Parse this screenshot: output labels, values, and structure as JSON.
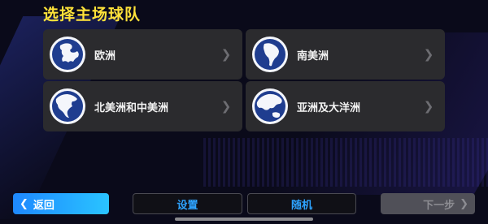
{
  "screen": {
    "title": "选择主场球队"
  },
  "regions": [
    {
      "label": "欧洲",
      "icon": "globe-europe-icon"
    },
    {
      "label": "南美洲",
      "icon": "globe-south-america-icon"
    },
    {
      "label": "北美洲和中美洲",
      "icon": "globe-north-america-icon"
    },
    {
      "label": "亚洲及大洋洲",
      "icon": "globe-asia-oceania-icon"
    }
  ],
  "footer": {
    "back_label": "返回",
    "settings_label": "设置",
    "random_label": "随机",
    "next_label": "下一步"
  },
  "colors": {
    "title": "#ffe23a",
    "accent": "#2ea3ff",
    "card": "#2b2b2e",
    "disabled": "#505058"
  }
}
